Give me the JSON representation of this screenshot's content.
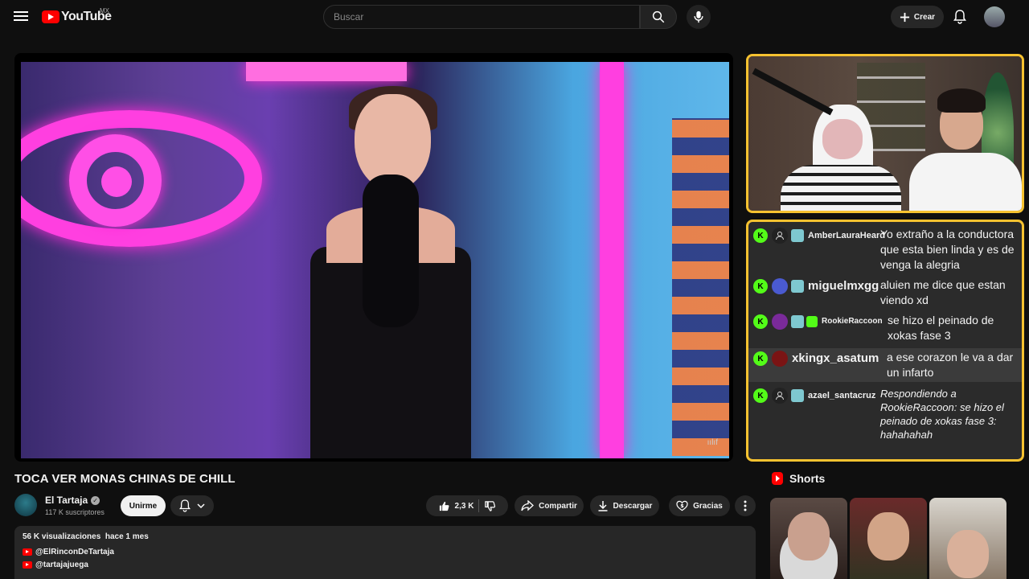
{
  "header": {
    "logo_text": "YouTube",
    "country": "MX",
    "search_placeholder": "Buscar",
    "create_label": "Crear"
  },
  "video": {
    "title": "TOCA VER MONAS CHINAS DE CHILL",
    "watermark": "ıılıf"
  },
  "channel": {
    "name": "El Tartaja",
    "verified_mark": "✓",
    "subscribers": "117 K suscriptores",
    "join_label": "Unirme"
  },
  "actions": {
    "likes": "2,3 K",
    "share_label": "Compartir",
    "download_label": "Descargar",
    "thanks_label": "Gracias"
  },
  "description": {
    "views": "56 K visualizaciones",
    "date": "hace 1 mes",
    "links": [
      "@ElRinconDeTartaja",
      "@tartajajuega"
    ]
  },
  "chat": {
    "messages": [
      {
        "user": "AmberLauraHeard",
        "text": "Yo extraño a la conductora que esta bien linda y es de venga la alegria"
      },
      {
        "user": "miguelmxgg",
        "text": "aluien me dice que estan viendo xd"
      },
      {
        "user": "RookieRaccoon",
        "text": "se hizo el peinado de xokas fase 3"
      },
      {
        "user": "xkingx_asatum",
        "text": "a ese corazon le va a dar un infarto"
      },
      {
        "user": "azael_santacruz",
        "text": "Respondiendo a RookieRaccoon: se hizo el peinado de xokas fase 3: hahahahah"
      }
    ],
    "kick_letter": "K"
  },
  "shorts": {
    "title": "Shorts"
  },
  "colors": {
    "accent_red": "#ff0000",
    "overlay_border": "#f6c230",
    "kick_green": "#53fc18"
  }
}
